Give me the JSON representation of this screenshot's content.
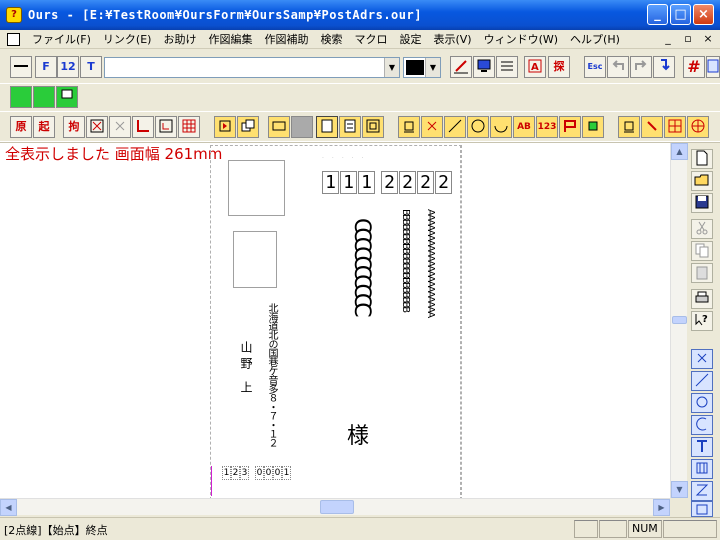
{
  "window": {
    "title": "Ours - [E:¥TestRoom¥OursForm¥OursSamp¥PostAdrs.our]",
    "app_icon_glyph": "?",
    "minimize_glyph": "_",
    "maximize_glyph": "□",
    "close_glyph": "×"
  },
  "menu": {
    "items": [
      "ファイル(F)",
      "リンク(E)",
      "お助け",
      "作図編集",
      "作図補助",
      "検索",
      "マクロ",
      "設定",
      "表示(V)",
      "ウィンドウ(W)",
      "ヘルプ(H)"
    ],
    "mdi_minimize": "_",
    "mdi_restore": "▫",
    "mdi_close": "×"
  },
  "toolbar1": {
    "font_btn": "F",
    "size_btn": "12",
    "text_btn": "T",
    "font_input_value": "",
    "dropdown_glyph": "▼",
    "color_value": "#000000",
    "search_label": "探",
    "esc_label": "Esc",
    "grid_label": "#"
  },
  "toolbar3": {
    "gen_label": "原",
    "ki_label": "起",
    "kou_label": "拘",
    "ab_label": "AB",
    "num_label": "123"
  },
  "canvas": {
    "message": "全表示しました 画面幅 261mm",
    "recipient_zip": [
      "1",
      "1",
      "1",
      "2",
      "2",
      "2",
      "2"
    ],
    "recipient_name_line": "CCCCCCCCCC",
    "recipient_b_line": "BBBBBBBBBBBBBBBBBBBBB",
    "recipient_a_line": "AAAAAAAAAAAAAAAAAAAAA",
    "honorific": "様",
    "sender_address": "北海道北の国巷ケ音多８・７・１２",
    "sender_name": "山野 上",
    "sender_zip": [
      "1",
      "2",
      "3",
      "0",
      "0",
      "0",
      "1"
    ]
  },
  "statusbar": {
    "text": "[2点線]【始点】終点",
    "num_indicator": "NUM"
  },
  "colors": {
    "message": "#d00000",
    "accent_blue": "#0a50d0"
  }
}
